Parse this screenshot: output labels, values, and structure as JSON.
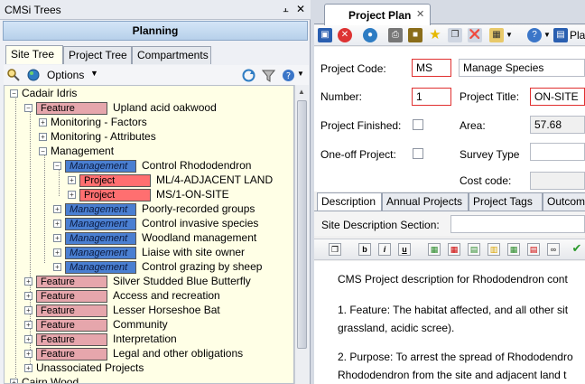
{
  "left_panel": {
    "title": "CMSi Trees",
    "planning_label": "Planning",
    "tabs": [
      "Site Tree",
      "Project Tree",
      "Compartments"
    ],
    "options_label": "Options",
    "tree": {
      "root1": "Cadair Idris",
      "feature_tag": "Feature",
      "mgmt_tag": "Management",
      "project_tag": "Project",
      "feature1": "Upland acid oakwood",
      "monitoring_factors": "Monitoring - Factors",
      "monitoring_attributes": "Monitoring - Attributes",
      "management": "Management",
      "mgmt_items": [
        "Control Rhododendron",
        "Poorly-recorded groups",
        "Control invasive species",
        "Woodland management",
        "Liaise with site owner",
        "Control grazing by sheep"
      ],
      "projects": [
        "ML/4-ADJACENT LAND",
        "MS/1-ON-SITE"
      ],
      "features": [
        "Silver Studded Blue Butterfly",
        "Access and recreation",
        "Lesser Horseshoe Bat",
        "Community",
        "Interpretation",
        "Legal and other obligations"
      ],
      "unassociated": "Unassociated Projects",
      "root2": "Cairn Wood"
    }
  },
  "right_panel": {
    "doc_tab": "Project Plan",
    "toolbar_trailing": "Pla",
    "form": {
      "project_code_label": "Project Code:",
      "project_code_value": "MS",
      "project_code_desc": "Manage Species",
      "number_label": "Number:",
      "number_value": "1",
      "project_title_label": "Project Title:",
      "project_title_value": "ON-SITE",
      "project_finished_label": "Project Finished:",
      "area_label": "Area:",
      "area_value": "57.68",
      "oneoff_label": "One-off Project:",
      "survey_type_label": "Survey Type",
      "cost_code_label": "Cost code:"
    },
    "sub_tabs": [
      "Description",
      "Annual Projects",
      "Project Tags",
      "Outcome"
    ],
    "site_desc_label": "Site Description Section:",
    "editor_lines": [
      "CMS Project description for Rhododendron cont",
      "1. Feature: The habitat affected, and all other sit",
      "grassland, acidic scree).",
      "2. Purpose: To arrest the spread of Rhododendro",
      "Rhododendron from the site and adjacent land t"
    ]
  },
  "colors": {
    "feature": "#e6a6ac",
    "management": "#4a7fd1",
    "project": "#ff6f70",
    "tree_bg": "#ffffe6",
    "error_border": "#e03030"
  }
}
